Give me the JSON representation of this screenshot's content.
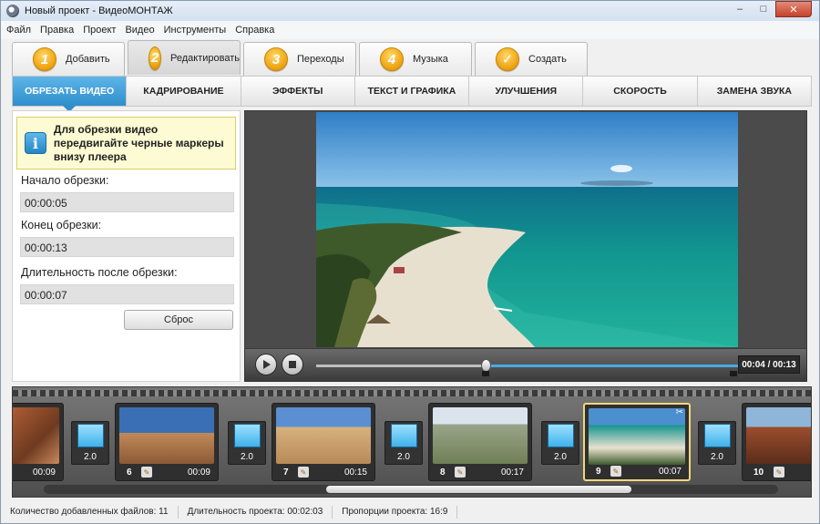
{
  "window": {
    "title": "Новый проект - ВидеоМОНТАЖ",
    "minimize": "–",
    "maximize": "□",
    "close": "✕"
  },
  "menu": [
    "Файл",
    "Правка",
    "Проект",
    "Видео",
    "Инструменты",
    "Справка"
  ],
  "steps": [
    {
      "num": "1",
      "label": "Добавить"
    },
    {
      "num": "2",
      "label": "Редактировать"
    },
    {
      "num": "3",
      "label": "Переходы"
    },
    {
      "num": "4",
      "label": "Музыка"
    },
    {
      "num": "✓",
      "label": "Создать"
    }
  ],
  "tabs": [
    "ОБРЕЗАТЬ ВИДЕО",
    "КАДРИРОВАНИЕ",
    "ЭФФЕКТЫ",
    "ТЕКСТ И ГРАФИКА",
    "УЛУЧШЕНИЯ",
    "СКОРОСТЬ",
    "ЗАМЕНА ЗВУКА"
  ],
  "trim": {
    "info": "Для обрезки видео передвигайте черные маркеры внизу плеера",
    "start_label": "Начало обрезки:",
    "start_value": "00:00:05",
    "end_label": "Конец обрезки:",
    "end_value": "00:00:13",
    "duration_label": "Длительность после обрезки:",
    "duration_value": "00:00:07",
    "reset_label": "Сброс"
  },
  "player": {
    "time": "00:04 / 00:13",
    "progress_fraction": 0.31
  },
  "timeline": {
    "clips": [
      {
        "num": "",
        "dur": "00:09"
      },
      {
        "num": "6",
        "dur": "00:09"
      },
      {
        "num": "7",
        "dur": "00:15"
      },
      {
        "num": "8",
        "dur": "00:17"
      },
      {
        "num": "9",
        "dur": "00:07"
      },
      {
        "num": "10",
        "dur": ""
      }
    ],
    "transitions": [
      "2.0",
      "2.0",
      "2.0",
      "2.0",
      "2.0"
    ]
  },
  "status": {
    "files": "Количество добавленных файлов: 11",
    "duration": "Длительность проекта:   00:02:03",
    "aspect": "Пропорции проекта:   16:9"
  }
}
